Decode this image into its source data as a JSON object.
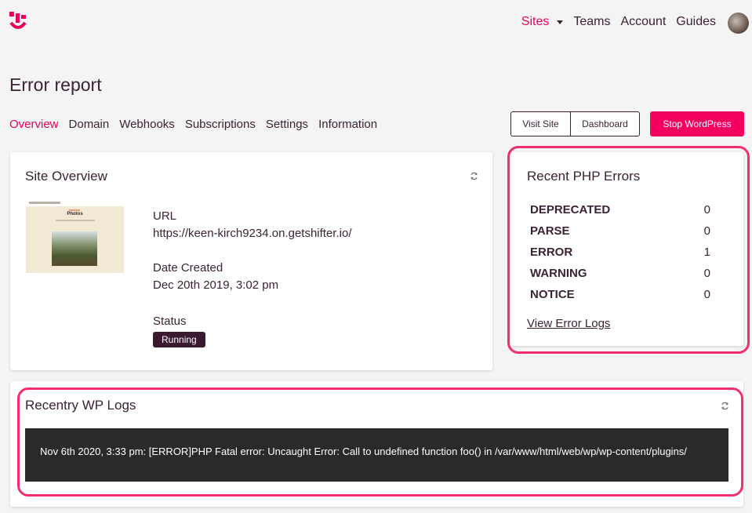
{
  "nav": {
    "items": [
      {
        "label": "Sites",
        "active": true
      },
      {
        "label": "Teams",
        "active": false
      },
      {
        "label": "Account",
        "active": false
      },
      {
        "label": "Guides",
        "active": false
      }
    ]
  },
  "page": {
    "title": "Error report"
  },
  "tabs": [
    {
      "label": "Overview",
      "active": true
    },
    {
      "label": "Domain",
      "active": false
    },
    {
      "label": "Webhooks",
      "active": false
    },
    {
      "label": "Subscriptions",
      "active": false
    },
    {
      "label": "Settings",
      "active": false
    },
    {
      "label": "Information",
      "active": false
    }
  ],
  "actions": {
    "visit_site": "Visit Site",
    "dashboard": "Dashboard",
    "stop": "Stop WordPress"
  },
  "overview": {
    "title": "Site Overview",
    "thumb_title": "Photos",
    "url_label": "URL",
    "url": "https://keen-kirch9234.on.getshifter.io/",
    "date_label": "Date Created",
    "date": "Dec 20th 2019, 3:02 pm",
    "status_label": "Status",
    "status": "Running"
  },
  "php_errors": {
    "title": "Recent PHP Errors",
    "rows": [
      {
        "name": "DEPRECATED",
        "count": "0"
      },
      {
        "name": "PARSE",
        "count": "0"
      },
      {
        "name": "ERROR",
        "count": "1"
      },
      {
        "name": "WARNING",
        "count": "0"
      },
      {
        "name": "NOTICE",
        "count": "0"
      }
    ],
    "link": "View Error Logs"
  },
  "wp_logs": {
    "title": "Recentry WP Logs",
    "lines": [
      "Nov 6th 2020, 3:33 pm: [ERROR]PHP Fatal error:  Uncaught Error: Call to undefined function foo() in /var/www/html/web/wp/wp-content/plugins/"
    ]
  },
  "colors": {
    "accent": "#e8005a",
    "stop_button": "#f4005f",
    "text": "#3a2334",
    "highlight": "#f0306e",
    "log_bg": "#2a2a2a"
  }
}
